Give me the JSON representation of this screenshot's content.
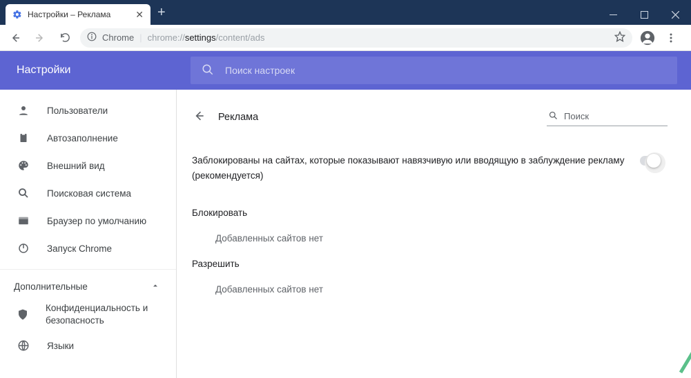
{
  "tab": {
    "title": "Настройки – Реклама"
  },
  "omnibox": {
    "scheme_label": "Chrome",
    "url_dim1": "chrome://",
    "url_dark": "settings",
    "url_dim2": "/content/ads"
  },
  "header": {
    "title": "Настройки"
  },
  "search": {
    "placeholder": "Поиск настроек"
  },
  "sidebar": {
    "items": [
      {
        "label": "Пользователи"
      },
      {
        "label": "Автозаполнение"
      },
      {
        "label": "Внешний вид"
      },
      {
        "label": "Поисковая система"
      },
      {
        "label": "Браузер по умолчанию"
      },
      {
        "label": "Запуск Chrome"
      }
    ],
    "advanced_label": "Дополнительные",
    "advanced_items": [
      {
        "label": "Конфиденциальность и безопасность"
      },
      {
        "label": "Языки"
      }
    ]
  },
  "content": {
    "title": "Реклама",
    "inline_search_placeholder": "Поиск",
    "toggle_text": "Заблокированы на сайтах, которые показывают навязчивую или вводящую в заблуждение рекламу (рекомендуется)",
    "block_title": "Блокировать",
    "block_empty": "Добавленных сайтов нет",
    "allow_title": "Разрешить",
    "allow_empty": "Добавленных сайтов нет"
  }
}
